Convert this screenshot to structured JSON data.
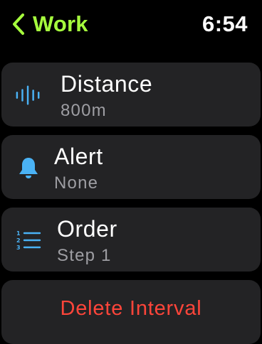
{
  "status_bar": {
    "back_label": "Work",
    "time": "6:54"
  },
  "rows": [
    {
      "title": "Distance",
      "subtitle": "800m",
      "icon": "distance-waveform-icon"
    },
    {
      "title": "Alert",
      "subtitle": "None",
      "icon": "bell-icon"
    },
    {
      "title": "Order",
      "subtitle": "Step 1",
      "icon": "numbered-list-icon"
    }
  ],
  "delete_button": {
    "label": "Delete Interval"
  },
  "colors": {
    "accent_green": "#a6ff3d",
    "icon_blue": "#4ab2f5",
    "destructive_red": "#ff453a",
    "row_background": "#232325",
    "secondary_text": "#9e9ea3"
  }
}
